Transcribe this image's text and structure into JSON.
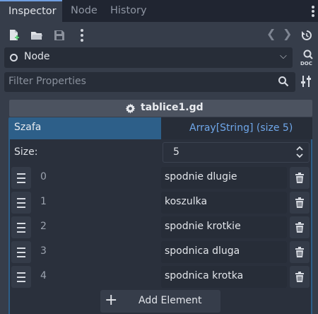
{
  "tabs": [
    {
      "label": "Inspector",
      "active": true
    },
    {
      "label": "Node",
      "active": false
    },
    {
      "label": "History",
      "active": false
    }
  ],
  "toolbar": {
    "icons": [
      "new-resource-icon",
      "open-folder-icon",
      "save-icon",
      "menu-dots-icon",
      "back-arrow-icon",
      "forward-arrow-icon",
      "history-icon"
    ],
    "back": "❮",
    "forward": "❯"
  },
  "object_selector": {
    "value": "Node",
    "icon": "node-circle-icon"
  },
  "filter": {
    "placeholder": "Filter Properties"
  },
  "script": {
    "title": "tablice1.gd"
  },
  "property": {
    "name": "Szafa",
    "value": "Array[String] (size 5)"
  },
  "array": {
    "size_label": "Size:",
    "size_value": "5",
    "elements": [
      {
        "index": "0",
        "value": "spodnie dlugie"
      },
      {
        "index": "1",
        "value": "koszulka"
      },
      {
        "index": "2",
        "value": "spodnie krotkie"
      },
      {
        "index": "3",
        "value": "spodnica dluga"
      },
      {
        "index": "4",
        "value": "spodnica krotka"
      }
    ],
    "add_label": "Add Element"
  },
  "colors": {
    "accent": "#2d5f89",
    "link": "#6fa7ea",
    "background": "#363d4a"
  }
}
